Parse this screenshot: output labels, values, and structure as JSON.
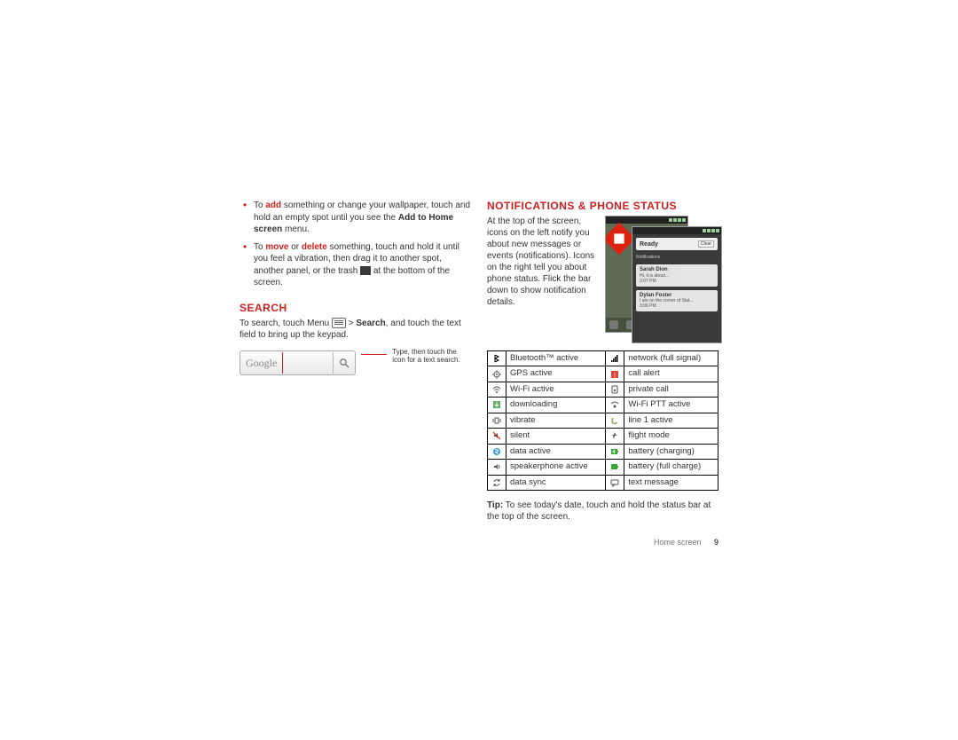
{
  "left": {
    "bullets": {
      "add": {
        "pre": "To ",
        "kw": "add",
        "post": " something or change your wallpaper, touch and hold an empty spot until you see the ",
        "bold2": "Add to Home screen",
        "post2": " menu."
      },
      "move": {
        "pre": "To ",
        "kw1": "move",
        "mid": " or ",
        "kw2": "delete",
        "post": " something, touch and hold it until you feel a vibration, then drag it to another spot, another panel, or the trash ",
        "post2": " at the bottom of the screen."
      }
    },
    "search": {
      "heading": "SEARCH",
      "text_pre": "To search, touch Menu ",
      "text_mid": " > ",
      "text_kw": "Search",
      "text_post": ", and touch the text field to bring up the keypad.",
      "brand": "Google",
      "callout": "Type, then touch the icon for a text search."
    }
  },
  "right": {
    "heading": "NOTIFICATIONS & PHONE STATUS",
    "para": "At the top of the screen, icons on the left notify you about new messages or events (notifications). Icons on the right tell you about phone status. Flick the bar down to show notification details.",
    "phone_panel": {
      "ready": "Ready",
      "clear": "Clear",
      "notif_label": "Notifications",
      "n1_name": "Sarah Dion",
      "n1_line": "Hi, it is about...",
      "n1_time": "3:07 PM",
      "n2_name": "Dylan Foster",
      "n2_line": "I am on the corner of Stat...",
      "n2_time": "3:06 PM"
    },
    "table": [
      {
        "li": "bt",
        "lt": "Bluetooth™ active",
        "ri": "net",
        "rt": "network (full signal)"
      },
      {
        "li": "gps",
        "lt": "GPS active",
        "ri": "alert",
        "rt": "call alert"
      },
      {
        "li": "wifi",
        "lt": "Wi-Fi active",
        "ri": "priv",
        "rt": "private call"
      },
      {
        "li": "dl",
        "lt": "downloading",
        "ri": "ptt",
        "rt": "Wi-Fi PTT active"
      },
      {
        "li": "vib",
        "lt": "vibrate",
        "ri": "l1",
        "rt": "line 1 active"
      },
      {
        "li": "sil",
        "lt": "silent",
        "ri": "fm",
        "rt": "flight mode"
      },
      {
        "li": "da",
        "lt": "data active",
        "ri": "bc",
        "rt": "battery (charging)"
      },
      {
        "li": "spk",
        "lt": "speakerphone active",
        "ri": "bf",
        "rt": "battery (full charge)"
      },
      {
        "li": "sync",
        "lt": "data sync",
        "ri": "msg",
        "rt": "text message"
      }
    ],
    "tip_label": "Tip:",
    "tip_text": " To see today's date, touch and hold the status bar at the top of the screen.",
    "footer_label": "Home screen",
    "footer_page": "9"
  },
  "icons": {
    "bt": "<svg viewBox='0 0 10 10'><path d='M3 1 L7 3 L3 5 L7 7 L3 9 M3 1 L3 9' stroke='#000' fill='none' stroke-width='1'/></svg>",
    "gps": "<svg viewBox='0 0 10 10'><circle cx='5' cy='5' r='3' fill='none' stroke='#555'/><circle cx='5' cy='5' r='1' fill='#555'/><line x1='5' y1='0' x2='5' y2='2' stroke='#555'/><line x1='5' y1='8' x2='5' y2='10' stroke='#555'/><line x1='0' y1='5' x2='2' y2='5' stroke='#555'/><line x1='8' y1='5' x2='10' y2='5' stroke='#555'/></svg>",
    "wifi": "<svg viewBox='0 0 10 10'><path d='M1 4 Q5 0 9 4' stroke='#555' fill='none'/><path d='M2.5 6 Q5 3.5 7.5 6' stroke='#555' fill='none'/><circle cx='5' cy='8' r='1' fill='#555'/></svg>",
    "dl": "<svg viewBox='0 0 10 10'><rect x='1' y='1' width='8' height='8' fill='#6a6'/><path d='M5 2 L5 6 M3 5 L5 7 L7 5' stroke='#fff' fill='none'/></svg>",
    "vib": "<svg viewBox='0 0 10 10'><rect x='3' y='2' width='4' height='6' fill='none' stroke='#555'/><line x1='1' y1='3' x2='1' y2='7' stroke='#555'/><line x1='9' y1='3' x2='9' y2='7' stroke='#555'/></svg>",
    "sil": "<svg viewBox='0 0 10 10'><path d='M2 4 L4 4 L6 2 L6 8 L4 6 L2 6 Z' fill='#555'/><line x1='1' y1='1' x2='9' y2='9' stroke='#d21' stroke-width='1.2'/></svg>",
    "da": "<svg viewBox='0 0 10 10'><circle cx='5' cy='5' r='4' fill='#39d'/><path d='M3 3 Q5 2 7 4 Q5 6 3 5 Q5 7 7 7' stroke='#fff' fill='none'/></svg>",
    "spk": "<svg viewBox='0 0 10 10'><path d='M2 4 L4 4 L6 2 L6 8 L4 6 L2 6 Z' fill='#555'/><path d='M7 3 Q9 5 7 7' stroke='#555' fill='none'/></svg>",
    "sync": "<svg viewBox='0 0 10 10'><path d='M8 3 A3.5 3.5 0 0 0 2 4' stroke='#555' fill='none'/><path d='M2 7 A3.5 3.5 0 0 0 8 6' stroke='#555' fill='none'/><path d='M8 1 L8 3 L6 3' stroke='#555' fill='none'/><path d='M2 9 L2 7 L4 7' stroke='#555' fill='none'/></svg>",
    "net": "<svg viewBox='0 0 10 10'><rect x='1' y='7' width='1.5' height='2' fill='#000'/><rect x='3' y='5' width='1.5' height='4' fill='#000'/><rect x='5' y='3' width='1.5' height='6' fill='#000'/><rect x='7' y='1' width='1.5' height='8' fill='#000'/></svg>",
    "alert": "<svg viewBox='0 0 10 10'><rect x='1' y='1' width='8' height='8' fill='#d43'/><text x='5' y='8' font-size='7' text-anchor='middle' fill='#fff'>!</text></svg>",
    "priv": "<svg viewBox='0 0 10 10'><rect x='2' y='1' width='6' height='8' rx='1' fill='none' stroke='#555'/><rect x='4' y='5' width='2' height='2' fill='#555'/></svg>",
    "ptt": "<svg viewBox='0 0 10 10'><path d='M1 4 Q5 0 9 4' stroke='#555' fill='none'/><circle cx='5' cy='7' r='1.5' fill='#555'/></svg>",
    "l1": "<svg viewBox='0 0 10 10'><path d='M3 2 Q1 5 3 8 Q6 9 8 7' stroke='#8a5' fill='none' stroke-width='1.5'/></svg>",
    "fm": "<svg viewBox='0 0 10 10'><path d='M5 1 L6 4 L9 5 L5 5 L4 9 L3 5 L1 5 L4 4 Z' fill='#555'/></svg>",
    "bc": "<svg viewBox='0 0 10 10'><rect x='1' y='2' width='7' height='6' fill='#3a3'/><rect x='8' y='4' width='1' height='2' fill='#3a3'/><path d='M5 3 L3 5 L5 5 L4 7' stroke='#fff' fill='none'/></svg>",
    "bf": "<svg viewBox='0 0 10 10'><rect x='1' y='2' width='7' height='6' fill='#3a3'/><rect x='8' y='4' width='1' height='2' fill='#3a3'/></svg>",
    "msg": "<svg viewBox='0 0 10 10'><rect x='1' y='2' width='8' height='5' rx='1' fill='none' stroke='#555'/><path d='M3 7 L3 9 L5 7' fill='none' stroke='#555'/></svg>"
  }
}
